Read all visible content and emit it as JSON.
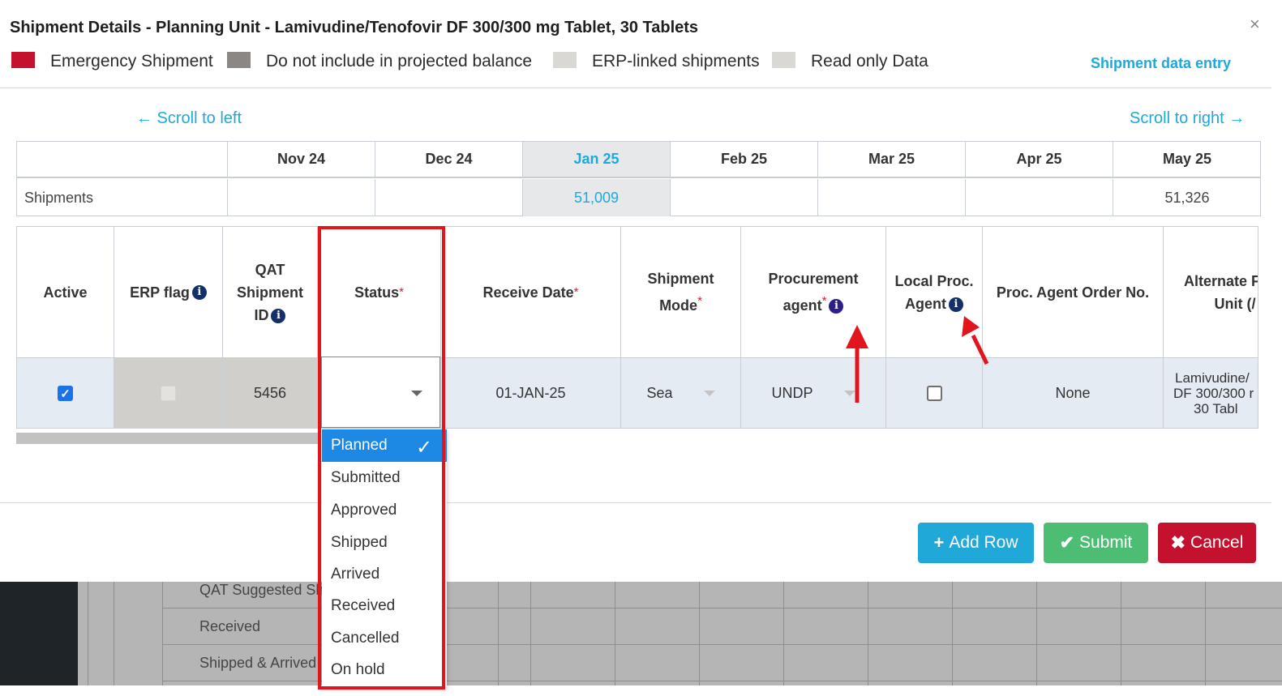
{
  "modal": {
    "title": "Shipment Details - Planning Unit - Lamivudine/Tenofovir DF 300/300 mg Tablet, 30 Tablets",
    "close": "×",
    "entry_link": "Shipment data entry",
    "legend": [
      {
        "label": "Emergency Shipment",
        "color": "#c4122e"
      },
      {
        "label": "Do not include in projected balance",
        "color": "#8a8784"
      },
      {
        "label": "ERP-linked shipments",
        "color": "#d9d8d5"
      },
      {
        "label": "Read only Data",
        "color": "#d9d8d5"
      }
    ],
    "scroll_left": "← Scroll to left",
    "scroll_right": "Scroll to right →"
  },
  "months": {
    "headers": [
      "Nov 24",
      "Dec 24",
      "Jan 25",
      "Feb 25",
      "Mar 25",
      "Apr 25",
      "May 25"
    ],
    "row_label": "Shipments",
    "values": [
      "",
      "",
      "51,009",
      "",
      "",
      "",
      "51,326"
    ],
    "highlight_color": "#20a8d8"
  },
  "grid": {
    "columns": {
      "active": "Active",
      "erp_flag": "ERP flag",
      "qat_id_l1": "QAT",
      "qat_id_l2": "Shipment",
      "qat_id_l3": "ID",
      "status": "Status",
      "receive_date": "Receive Date",
      "mode_l1": "Shipment",
      "mode_l2": "Mode",
      "agent_l1": "Procurement",
      "agent_l2": "agent",
      "local_l1": "Local Proc.",
      "local_l2": "Agent",
      "order_no": "Proc. Agent Order No.",
      "alt_l1": "Alternate F",
      "alt_l2": "Unit (/"
    },
    "required_mark": "*",
    "info_glyph": "i",
    "row": {
      "active": true,
      "erp_flag": false,
      "qat_id": "5456",
      "status": "",
      "receive_date": "01-JAN-25",
      "mode": "Sea",
      "agent": "UNDP",
      "local_agent": false,
      "order_no": "None",
      "alt_l1": "Lamivudine/",
      "alt_l2": "DF 300/300 r",
      "alt_l3": "30 Tabl"
    }
  },
  "status_dropdown": {
    "options": [
      "Planned",
      "Submitted",
      "Approved",
      "Shipped",
      "Arrived",
      "Received",
      "Cancelled",
      "On hold"
    ],
    "selected": "Planned",
    "check": "✓"
  },
  "buttons": {
    "add_icon": "+",
    "add": "Add Row",
    "submit_icon": "✔",
    "submit": "Submit",
    "cancel_icon": "✖",
    "cancel": "Cancel"
  },
  "background": {
    "rows": [
      "QAT Suggested Sh",
      "Received",
      "Shipped & Arrived"
    ]
  }
}
